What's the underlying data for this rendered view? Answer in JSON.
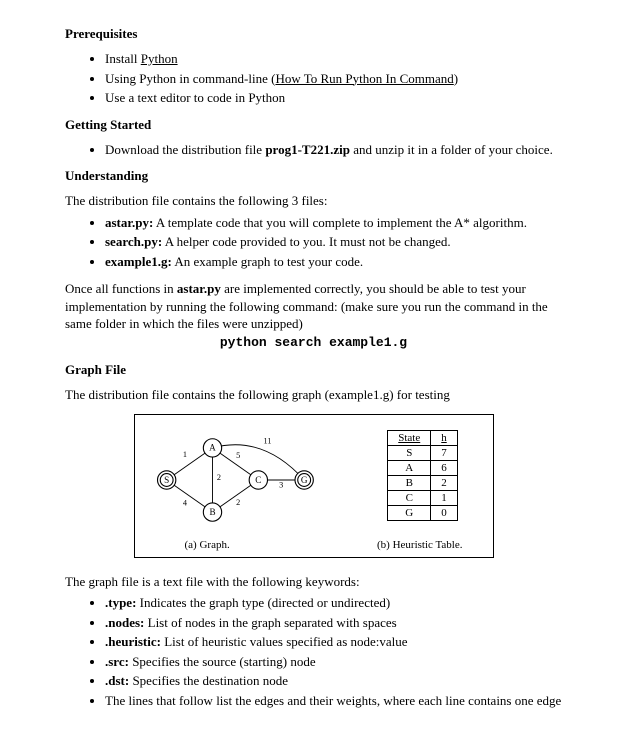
{
  "sections": {
    "prereq": {
      "title": "Prerequisites",
      "items": {
        "i0_a": "Install ",
        "i0_link": "Python",
        "i1_a": "Using Python in command-line (",
        "i1_link": "How To Run Python In Command",
        "i1_b": ")",
        "i2": "Use a text editor to code in Python"
      }
    },
    "getting_started": {
      "title": "Getting Started",
      "item_a": "Download the distribution file ",
      "item_bold": "prog1-T221.zip",
      "item_b": " and unzip it in a folder of your choice."
    },
    "understanding": {
      "title": "Understanding",
      "intro": "The distribution file contains the following 3 files:",
      "files": {
        "f0_name": "astar.py:",
        "f0_desc": " A template code that you will complete to implement the A* algorithm.",
        "f1_name": "search.py:",
        "f1_desc": " A helper code provided to you. It must not be changed.",
        "f2_name": "example1.g:",
        "f2_desc": "  An example graph to test your code."
      },
      "para_a": "Once all functions in ",
      "para_bold": "astar.py",
      "para_b": " are implemented correctly, you should be able to test your implementation by running the following command: (make sure you run the command in the same folder in which the files were unzipped)",
      "command": "python search example1.g"
    },
    "graph_file": {
      "title": "Graph File",
      "intro": "The distribution file contains the following graph (example1.g) for testing",
      "graph_nodes": {
        "S": "S",
        "A": "A",
        "B": "B",
        "C": "C",
        "G": "G"
      },
      "edge_labels": {
        "sa": "1",
        "sb": "4",
        "ab": "2",
        "ac": "5",
        "ag": "11",
        "bc": "2",
        "cg": "3"
      },
      "table": {
        "head_state": "State",
        "head_h": "h",
        "rows": [
          {
            "state": "S",
            "h": "7"
          },
          {
            "state": "A",
            "h": "6"
          },
          {
            "state": "B",
            "h": "2"
          },
          {
            "state": "C",
            "h": "1"
          },
          {
            "state": "G",
            "h": "0"
          }
        ]
      },
      "cap_a": "(a) Graph.",
      "cap_b": "(b) Heuristic Table.",
      "keywords_intro": "The graph file is a text file with the following keywords:",
      "kw": {
        "k0_name": ".type:",
        "k0_desc": " Indicates the graph type (directed or undirected)",
        "k1_name": ".nodes:",
        "k1_desc": " List of nodes in the graph separated with spaces",
        "k2_name": ".heuristic:",
        "k2_desc": " List of heuristic values specified as node:value",
        "k3_name": ".src:",
        "k3_desc": " Specifies the source (starting) node",
        "k4_name": ".dst:",
        "k4_desc": " Specifies the destination node",
        "k5": "The lines that follow list the edges and their weights, where each line contains one edge"
      }
    }
  }
}
